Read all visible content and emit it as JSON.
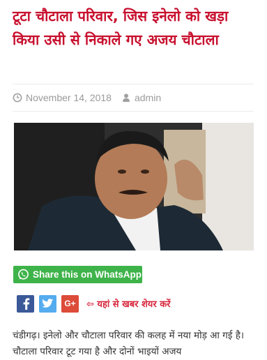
{
  "article": {
    "title": "टूटा चौटाला परिवार, जिस इनेलो को खड़ा किया उसी से निकाले गए अजय चौटाला",
    "date": "November 14, 2018",
    "author": "admin",
    "body": "चंडीगढ़। इनेलो और चौटाला परिवार की कलह में नया मोड़ आ गई है। चौटाला परिवार टूट गया है और दोनों भाइयों अजय"
  },
  "icons": {
    "date": "clock-icon",
    "author": "user-icon",
    "whatsapp": "whatsapp-icon",
    "facebook": "facebook-icon",
    "twitter": "twitter-icon",
    "googleplus": "google-plus-icon"
  },
  "share": {
    "whatsapp_label": "Share this on WhatsApp",
    "googleplus_label": "G+",
    "hint": "⇦ यहां से खबर शेयर करें"
  },
  "colors": {
    "title": "#c8102e",
    "whatsapp": "#3eb34a",
    "facebook": "#3b5998",
    "twitter": "#55acee",
    "googleplus": "#dd4b39",
    "hint": "#d7263d"
  }
}
